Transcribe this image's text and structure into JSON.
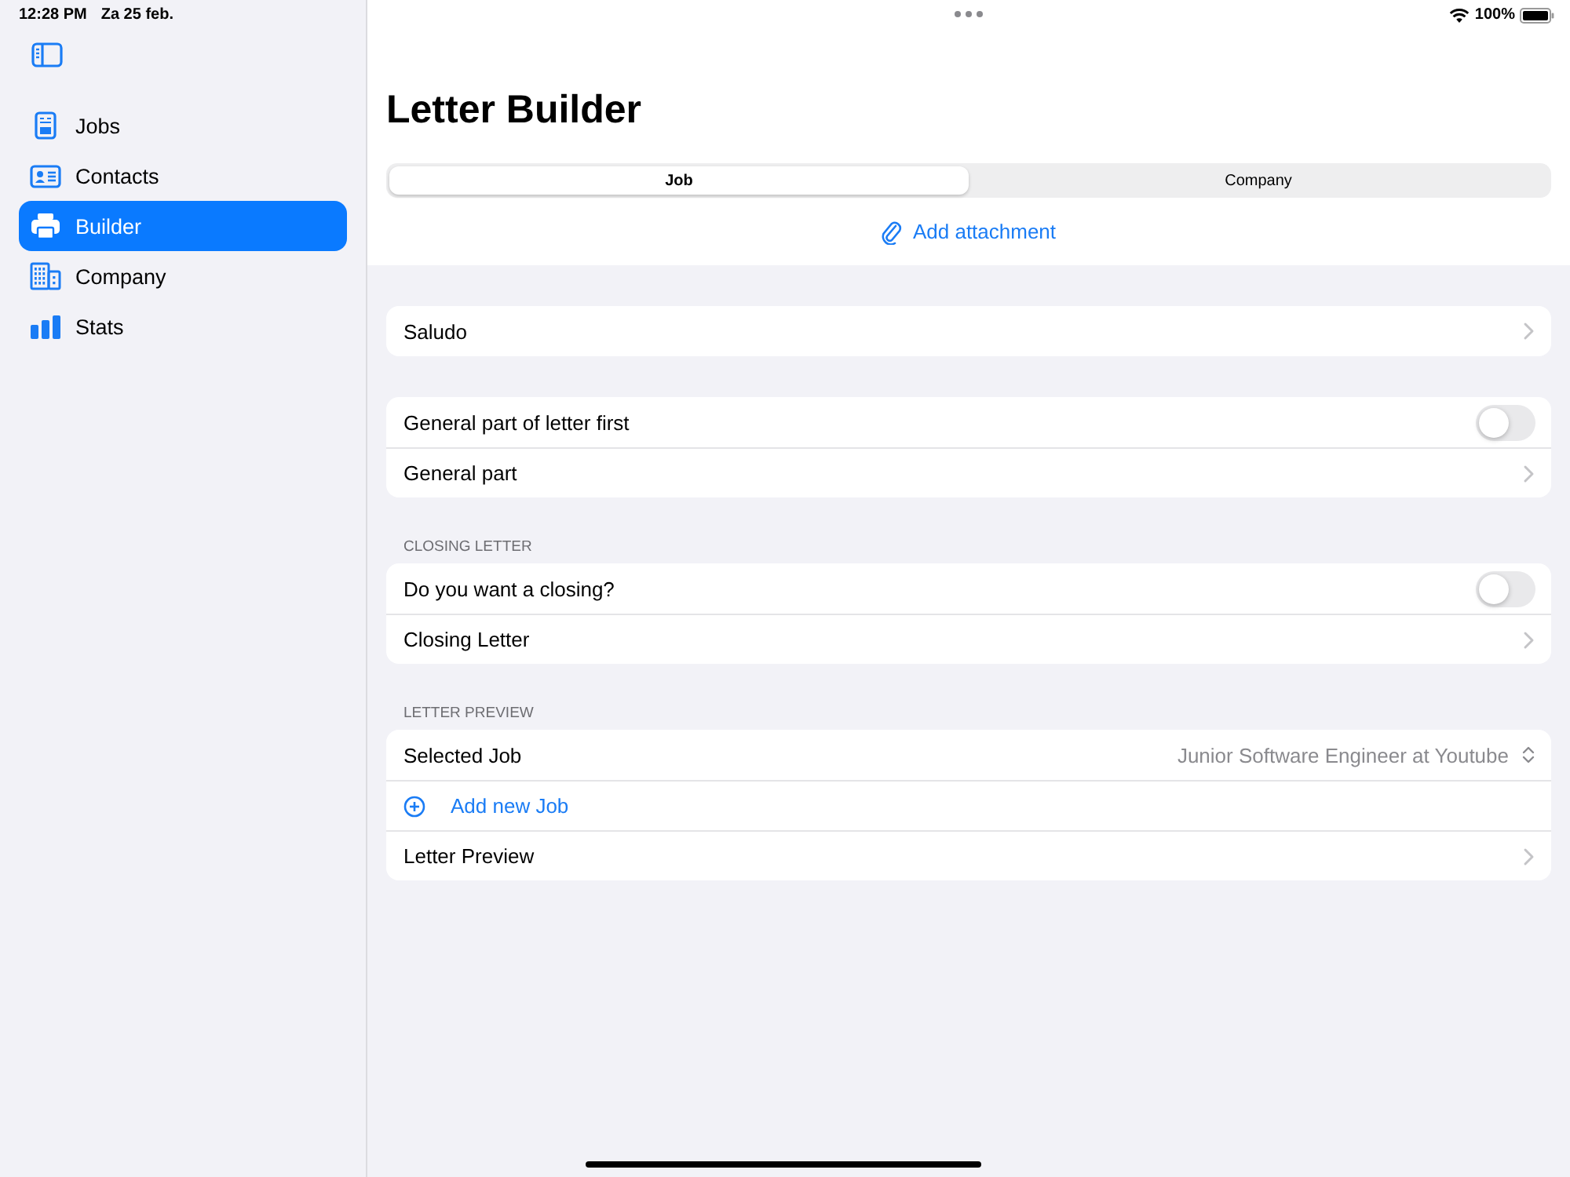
{
  "status_bar": {
    "time": "12:28 PM",
    "date": "Za 25 feb.",
    "battery": "100%"
  },
  "sidebar": {
    "items": [
      {
        "label": "Jobs",
        "selected": false
      },
      {
        "label": "Contacts",
        "selected": false
      },
      {
        "label": "Builder",
        "selected": true
      },
      {
        "label": "Company",
        "selected": false
      },
      {
        "label": "Stats",
        "selected": false
      }
    ]
  },
  "title": "Letter Builder",
  "segments": [
    {
      "label": "Job",
      "selected": true
    },
    {
      "label": "Company",
      "selected": false
    }
  ],
  "attachment_button": "Add attachment",
  "sections": [
    {
      "rows": [
        {
          "kind": "nav",
          "label": "Saludo"
        }
      ]
    },
    {
      "rows": [
        {
          "kind": "toggle",
          "label": "General part of letter first",
          "on": false
        },
        {
          "kind": "nav",
          "label": "General part"
        }
      ]
    },
    {
      "header": "CLOSING LETTER",
      "rows": [
        {
          "kind": "toggle",
          "label": "Do you want a closing?",
          "on": false
        },
        {
          "kind": "nav",
          "label": "Closing Letter"
        }
      ]
    },
    {
      "header": "LETTER PREVIEW",
      "rows": [
        {
          "kind": "picker",
          "label": "Selected Job",
          "value": "Junior Software Engineer at Youtube"
        },
        {
          "kind": "action",
          "label": "Add new Job"
        },
        {
          "kind": "nav",
          "label": "Letter Preview"
        }
      ]
    }
  ]
}
